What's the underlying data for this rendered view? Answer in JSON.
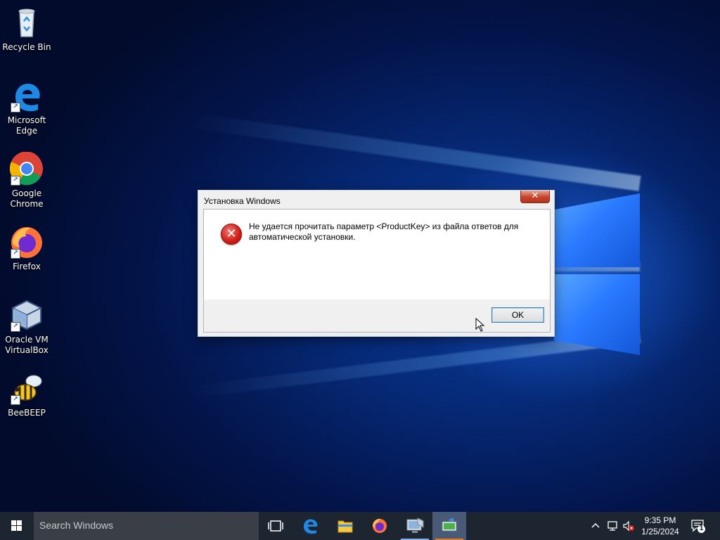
{
  "desktop": {
    "icons": [
      {
        "label_1": "Recycle Bin",
        "label_2": ""
      },
      {
        "label_1": "Microsoft",
        "label_2": "Edge"
      },
      {
        "label_1": "Google",
        "label_2": "Chrome"
      },
      {
        "label_1": "Firefox",
        "label_2": ""
      },
      {
        "label_1": "Oracle VM",
        "label_2": "VirtualBox"
      },
      {
        "label_1": "BeeBEEP",
        "label_2": ""
      }
    ]
  },
  "dialog": {
    "title": "Установка Windows",
    "close_glyph": "✕",
    "message_line1": "Не удается прочитать параметр <ProductKey> из файла ответов для",
    "message_line2": "автоматической установки.",
    "ok_label": "OK",
    "icon": "error-icon"
  },
  "taskbar": {
    "search_placeholder": "Search Windows",
    "apps": [
      "task-view",
      "edge",
      "file-explorer",
      "firefox",
      "windows-setup",
      "setup-active"
    ],
    "time": "9:35 PM",
    "date": "1/25/2024",
    "notification_count": "1"
  },
  "colors": {
    "taskbar_bg": "#1d2531",
    "accent": "#7fb2e8",
    "error_red": "#d01c15"
  }
}
